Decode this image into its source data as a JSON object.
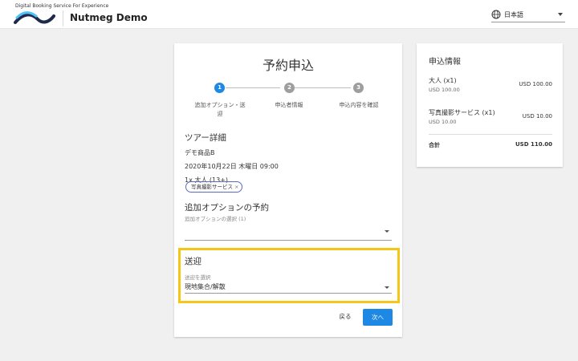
{
  "header": {
    "tagline": "Digital Booking Service For Experience",
    "app_title": "Nutmeg Demo",
    "language": "日本語"
  },
  "booking": {
    "title": "予約申込",
    "steps": [
      {
        "number": "1",
        "label_line1": "追加オプション・送",
        "label_line2": "迎",
        "state": "active"
      },
      {
        "number": "2",
        "label_line1": "申込者情報",
        "label_line2": "",
        "state": "inactive"
      },
      {
        "number": "3",
        "label_line1": "申込内容を確認",
        "label_line2": "",
        "state": "inactive"
      }
    ],
    "tour_section_title": "ツアー詳細",
    "product_name": "デモ商品B",
    "date_time": "2020年10月22日 木曜日 09:00",
    "guests": "1x 大人 (13+)",
    "options_section_title": "追加オプションの予約",
    "options_label": "追加オプションの選択 (1)",
    "option_chip": "写真撮影サービス",
    "transfer_section_title": "送迎",
    "transfer_label": "送迎を選択",
    "transfer_value": "現地集合/解散",
    "back_label": "戻る",
    "next_label": "次へ"
  },
  "summary": {
    "title": "申込情報",
    "items": [
      {
        "name": "大人 (x1)",
        "sub": "USD 100.00",
        "price": "USD 100.00"
      },
      {
        "name": "写真撮影サービス (x1)",
        "sub": "USD 10.00",
        "price": "USD 10.00"
      }
    ],
    "total_label": "合計",
    "total_price": "USD 110.00"
  },
  "colors": {
    "accent": "#1e88e5",
    "step_active": "#1e88e5",
    "step_inactive": "#9e9e9e",
    "highlight": "#f5c518",
    "chip_border": "#5c6bc0"
  }
}
